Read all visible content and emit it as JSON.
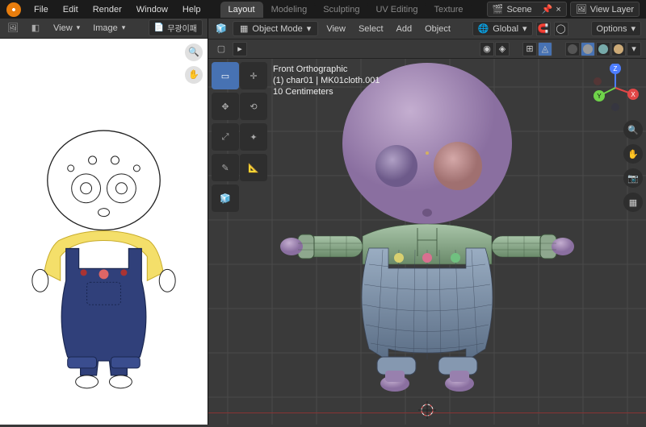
{
  "menus": {
    "file": "File",
    "edit": "Edit",
    "render": "Render",
    "window": "Window",
    "help": "Help"
  },
  "tabs": [
    "Layout",
    "Modeling",
    "Sculpting",
    "UV Editing",
    "Texture"
  ],
  "active_tab": 0,
  "scene": {
    "label": "Scene",
    "layer": "View Layer"
  },
  "left_editor": {
    "view": "View",
    "image": "Image",
    "title": "무광이패"
  },
  "right_editor": {
    "mode": "Object Mode",
    "menus": {
      "view": "View",
      "select": "Select",
      "add": "Add",
      "object": "Object"
    },
    "orientation": "Global",
    "options": "Options",
    "info": {
      "projection": "Front Orthographic",
      "object": "(1) char01 | MK01cloth.001",
      "grid": "10 Centimeters"
    }
  },
  "tools": [
    "select-box",
    "cursor",
    "move",
    "rotate",
    "scale",
    "transform",
    "annotate",
    "measure",
    "add-cube"
  ],
  "gizmo_axes": {
    "x": "X",
    "y": "Y",
    "z": "Z"
  },
  "colors": {
    "accent": "#4772b3",
    "purple": "#a58bb5",
    "green": "#8ea88e",
    "blue": "#7a8aa8"
  }
}
